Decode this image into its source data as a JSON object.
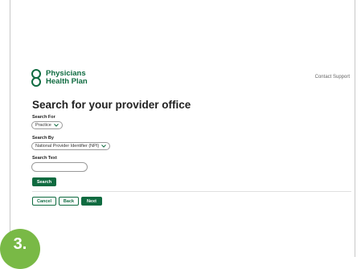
{
  "header": {
    "logo_line1": "Physicians",
    "logo_line2": "Health Plan",
    "contact_support": "Contact Support"
  },
  "main": {
    "title": "Search for your provider office",
    "search_for": {
      "label": "Search For",
      "value": "Practice"
    },
    "search_by": {
      "label": "Search By",
      "value": "National Provider Identifier (NPI)"
    },
    "search_text": {
      "label": "Search Text",
      "value": ""
    },
    "search_button": "Search"
  },
  "footer": {
    "cancel": "Cancel",
    "back": "Back",
    "next": "Next"
  },
  "step_badge": "3.",
  "colors": {
    "brand_green": "#0f6b40",
    "badge_green": "#79b946"
  }
}
